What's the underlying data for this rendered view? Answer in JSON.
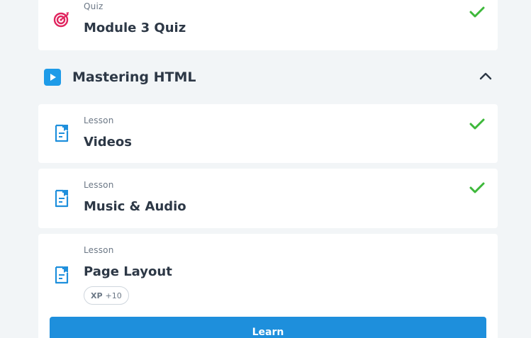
{
  "items": [
    {
      "kind": "Quiz",
      "title": "Module 3 Quiz",
      "icon": "target-icon",
      "completed": true
    },
    {
      "kind": "Lesson",
      "title": "Videos",
      "icon": "lesson-icon",
      "completed": true
    },
    {
      "kind": "Lesson",
      "title": "Music & Audio",
      "icon": "lesson-icon",
      "completed": true
    },
    {
      "kind": "Lesson",
      "title": "Page Layout",
      "icon": "lesson-icon",
      "completed": false
    }
  ],
  "section": {
    "title": "Mastering HTML",
    "icon": "play-icon",
    "expanded": true
  },
  "xp": {
    "label": "XP",
    "value": "+10"
  },
  "learn_button": {
    "label": "Learn"
  },
  "colors": {
    "check": "#3db83a",
    "lesson_icon": "#1e8fdc",
    "quiz_icon": "#e0245e",
    "play_bg": "#1e9be8",
    "button": "#1e8fdc",
    "background": "#f2f5f7"
  }
}
